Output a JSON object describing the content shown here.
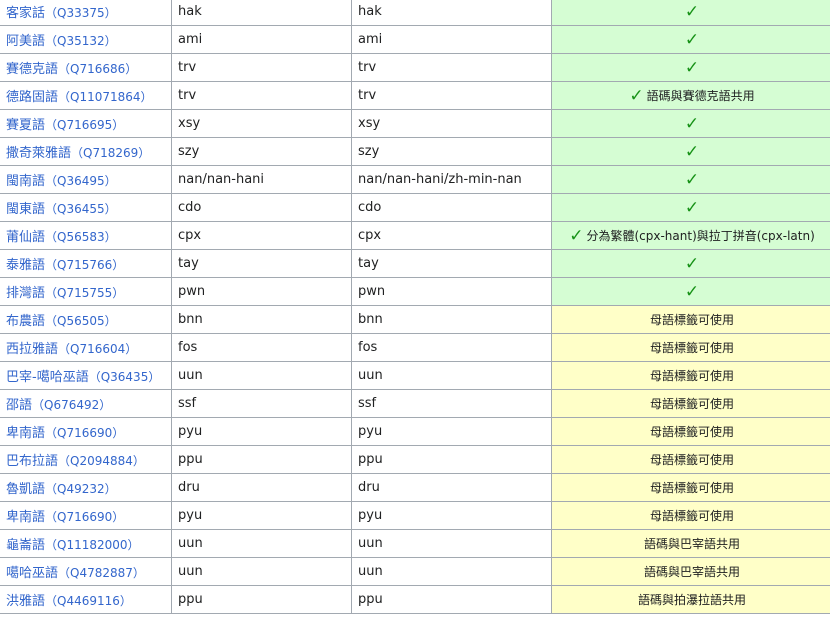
{
  "colors": {
    "supported_bg": "#d5fdd3",
    "partial_bg": "#ffffc8",
    "link": "#3366cc",
    "check": "#179217"
  },
  "rows": [
    {
      "lang": "客家話",
      "qid": "（Q33375）",
      "code": "hak",
      "code2": "hak",
      "status": "yes",
      "note": ""
    },
    {
      "lang": "阿美語",
      "qid": "（Q35132）",
      "code": "ami",
      "code2": "ami",
      "status": "yes",
      "note": ""
    },
    {
      "lang": "賽德克語",
      "qid": "（Q716686）",
      "code": "trv",
      "code2": "trv",
      "status": "yes",
      "note": ""
    },
    {
      "lang": "德路固語",
      "qid": "（Q11071864）",
      "code": "trv",
      "code2": "trv",
      "status": "yes",
      "note": "語碼與賽德克語共用"
    },
    {
      "lang": "賽夏語",
      "qid": "（Q716695）",
      "code": "xsy",
      "code2": "xsy",
      "status": "yes",
      "note": ""
    },
    {
      "lang": "撒奇萊雅語",
      "qid": "（Q718269）",
      "code": "szy",
      "code2": "szy",
      "status": "yes",
      "note": ""
    },
    {
      "lang": "閩南語",
      "qid": "（Q36495）",
      "code": "nan/nan-hani",
      "code2": "nan/nan-hani/zh-min-nan",
      "status": "yes",
      "note": ""
    },
    {
      "lang": "閩東語",
      "qid": "（Q36455）",
      "code": "cdo",
      "code2": "cdo",
      "status": "yes",
      "note": ""
    },
    {
      "lang": "莆仙語",
      "qid": "（Q56583）",
      "code": "cpx",
      "code2": "cpx",
      "status": "yes",
      "note": "分為繁體(cpx-hant)與拉丁拼音(cpx-latn)"
    },
    {
      "lang": "泰雅語",
      "qid": "（Q715766）",
      "code": "tay",
      "code2": "tay",
      "status": "yes",
      "note": ""
    },
    {
      "lang": "排灣語",
      "qid": "（Q715755）",
      "code": "pwn",
      "code2": "pwn",
      "status": "yes",
      "note": ""
    },
    {
      "lang": "布農語",
      "qid": "（Q56505）",
      "code": "bnn",
      "code2": "bnn",
      "status": "partial",
      "note": "母語標籤可使用"
    },
    {
      "lang": "西拉雅語",
      "qid": "（Q716604）",
      "code": "fos",
      "code2": "fos",
      "status": "partial",
      "note": "母語標籤可使用"
    },
    {
      "lang": "巴宰-噶哈巫語",
      "qid": "（Q36435）",
      "code": "uun",
      "code2": "uun",
      "status": "partial",
      "note": "母語標籤可使用"
    },
    {
      "lang": "邵語",
      "qid": "（Q676492）",
      "code": "ssf",
      "code2": "ssf",
      "status": "partial",
      "note": "母語標籤可使用"
    },
    {
      "lang": "卑南語",
      "qid": "（Q716690）",
      "code": "pyu",
      "code2": "pyu",
      "status": "partial",
      "note": "母語標籤可使用"
    },
    {
      "lang": "巴布拉語",
      "qid": "（Q2094884）",
      "code": "ppu",
      "code2": "ppu",
      "status": "partial",
      "note": "母語標籤可使用"
    },
    {
      "lang": "魯凱語",
      "qid": "（Q49232）",
      "code": "dru",
      "code2": "dru",
      "status": "partial",
      "note": "母語標籤可使用"
    },
    {
      "lang": "卑南語",
      "qid": "（Q716690）",
      "code": "pyu",
      "code2": "pyu",
      "status": "partial",
      "note": "母語標籤可使用"
    },
    {
      "lang": "龜崙語",
      "qid": "（Q11182000）",
      "code": "uun",
      "code2": "uun",
      "status": "partial",
      "note": "語碼與巴宰語共用"
    },
    {
      "lang": "噶哈巫語",
      "qid": "（Q4782887）",
      "code": "uun",
      "code2": "uun",
      "status": "partial",
      "note": "語碼與巴宰語共用"
    },
    {
      "lang": "洪雅語",
      "qid": "（Q4469116）",
      "code": "ppu",
      "code2": "ppu",
      "status": "partial",
      "note": "語碼與拍瀑拉語共用"
    }
  ]
}
